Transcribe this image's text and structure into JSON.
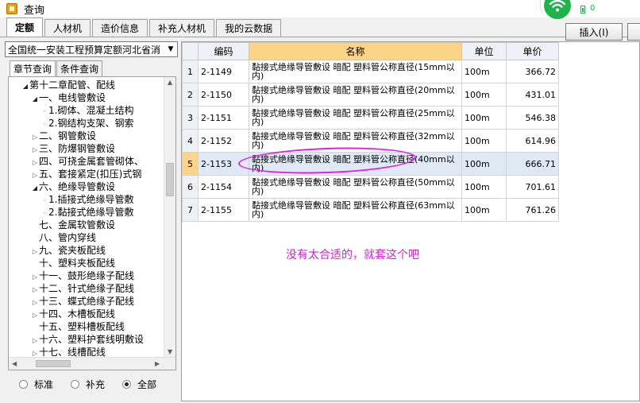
{
  "window": {
    "title": "查询"
  },
  "status_widget": {
    "count": "0"
  },
  "tabs": [
    "定额",
    "人材机",
    "造价信息",
    "补充人材机",
    "我的云数据"
  ],
  "toolbar": {
    "insert_label": "插入(I)"
  },
  "left_panel": {
    "combo_value": "全国统一安装工程预算定额河北省消",
    "subtabs": [
      "章节查询",
      "条件查询"
    ],
    "tree": [
      {
        "label": "第十二章配管、配线",
        "indent": 1,
        "toggle": "open"
      },
      {
        "label": "一、电线管敷设",
        "indent": 2,
        "toggle": "open"
      },
      {
        "label": "1.砌体、混凝土结构",
        "indent": 3,
        "toggle": "leaf"
      },
      {
        "label": "2.钢结构支架、钢索",
        "indent": 3,
        "toggle": "leaf"
      },
      {
        "label": "二、钢管敷设",
        "indent": 2,
        "toggle": "closed"
      },
      {
        "label": "三、防爆钢管敷设",
        "indent": 2,
        "toggle": "closed"
      },
      {
        "label": "四、可挠金属套管砌体、",
        "indent": 2,
        "toggle": "closed"
      },
      {
        "label": "五、套接紧定(扣压)式钢",
        "indent": 2,
        "toggle": "closed"
      },
      {
        "label": "六、绝缘导管敷设",
        "indent": 2,
        "toggle": "open"
      },
      {
        "label": "1.插接式绝缘导管敷",
        "indent": 3,
        "toggle": "leaf"
      },
      {
        "label": "2.黏接式绝缘导管敷",
        "indent": 3,
        "toggle": "leaf"
      },
      {
        "label": "七、金属软管敷设",
        "indent": 2,
        "toggle": "none"
      },
      {
        "label": "八、管内穿线",
        "indent": 2,
        "toggle": "none"
      },
      {
        "label": "九、瓷夹板配线",
        "indent": 2,
        "toggle": "closed"
      },
      {
        "label": "十、塑料夹板配线",
        "indent": 2,
        "toggle": "none"
      },
      {
        "label": "十一、鼓形绝缘子配线",
        "indent": 2,
        "toggle": "closed"
      },
      {
        "label": "十二、针式绝缘子配线",
        "indent": 2,
        "toggle": "closed"
      },
      {
        "label": "十三、蝶式绝缘子配线",
        "indent": 2,
        "toggle": "closed"
      },
      {
        "label": "十四、木槽板配线",
        "indent": 2,
        "toggle": "closed"
      },
      {
        "label": "十五、塑料槽板配线",
        "indent": 2,
        "toggle": "none"
      },
      {
        "label": "十六、塑料护套线明敷设",
        "indent": 2,
        "toggle": "closed"
      },
      {
        "label": "十七、线槽配线",
        "indent": 2,
        "toggle": "closed"
      }
    ],
    "radio_options": [
      "标准",
      "补充",
      "全部"
    ],
    "radio_selected": "全部"
  },
  "table": {
    "headers": [
      "",
      "编码",
      "名称",
      "单位",
      "单价"
    ],
    "rows": [
      {
        "no": "1",
        "code": "2-1149",
        "name": "黏接式绝缘导管敷设 暗配 塑料管公称直径(15mm以内)",
        "unit": "100m",
        "price": "366.72"
      },
      {
        "no": "2",
        "code": "2-1150",
        "name": "黏接式绝缘导管敷设 暗配 塑料管公称直径(20mm以内)",
        "unit": "100m",
        "price": "431.01"
      },
      {
        "no": "3",
        "code": "2-1151",
        "name": "黏接式绝缘导管敷设 暗配 塑料管公称直径(25mm以内)",
        "unit": "100m",
        "price": "546.38"
      },
      {
        "no": "4",
        "code": "2-1152",
        "name": "黏接式绝缘导管敷设 暗配 塑料管公称直径(32mm以内)",
        "unit": "100m",
        "price": "614.96"
      },
      {
        "no": "5",
        "code": "2-1153",
        "name": "黏接式绝缘导管敷设 暗配 塑料管公称直径(40mm以内)",
        "unit": "100m",
        "price": "666.71"
      },
      {
        "no": "6",
        "code": "2-1154",
        "name": "黏接式绝缘导管敷设 暗配 塑料管公称直径(50mm以内)",
        "unit": "100m",
        "price": "701.61"
      },
      {
        "no": "7",
        "code": "2-1155",
        "name": "黏接式绝缘导管敷设 暗配 塑料管公称直径(63mm以内)",
        "unit": "100m",
        "price": "761.26"
      }
    ],
    "selected_row": "5"
  },
  "annotation": "没有太合适的，就套这个吧",
  "colors": {
    "annotation": "#d020d0",
    "header_highlight": "#fcd48a",
    "wifi": "#22b14c"
  }
}
